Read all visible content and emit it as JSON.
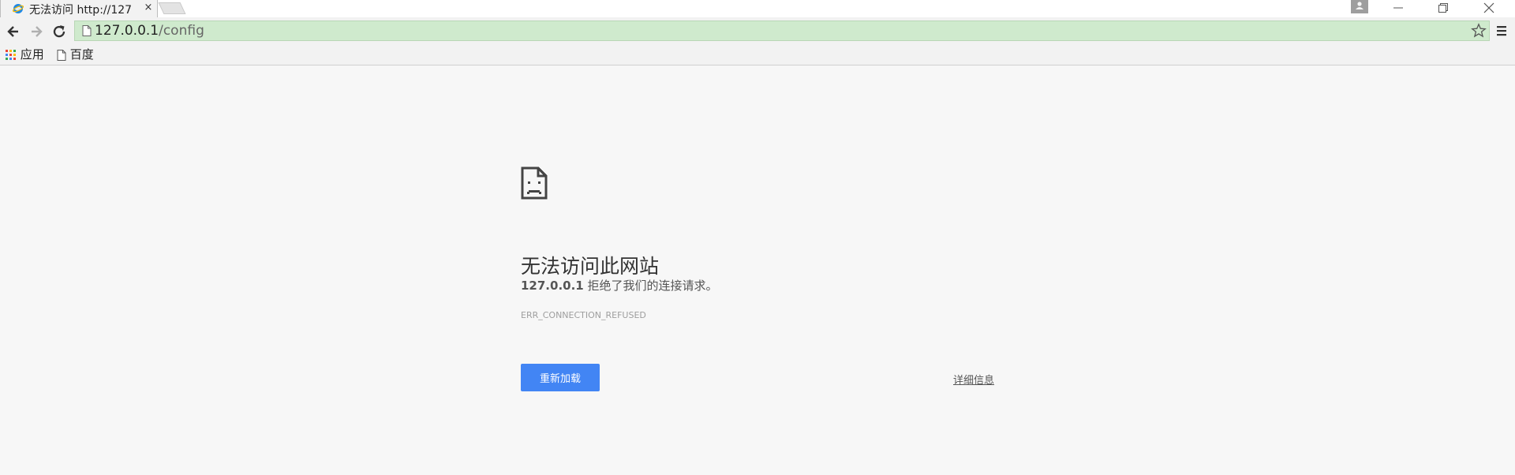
{
  "browser": {
    "tab": {
      "title": "无法访问 http://127",
      "close_glyph": "×",
      "favicon": "ie-globe-icon"
    },
    "window_controls": [
      "minimize-icon",
      "restore-icon",
      "close-icon"
    ],
    "toolbar": {
      "url_host": "127.0.0.1",
      "url_path": "/config"
    },
    "bookmarks": [
      {
        "label": "应用",
        "icon": "apps-grid-icon"
      },
      {
        "label": "百度",
        "icon": "page-icon"
      }
    ],
    "colors": {
      "omnibox_bg": "#cfeacd",
      "accent": "#4285f4"
    }
  },
  "error": {
    "icon": "sad-page-icon",
    "title": "无法访问此网站",
    "host": "127.0.0.1",
    "message": " 拒绝了我们的连接请求。",
    "code": "ERR_CONNECTION_REFUSED",
    "reload_label": "重新加载",
    "details_label": "详细信息"
  }
}
